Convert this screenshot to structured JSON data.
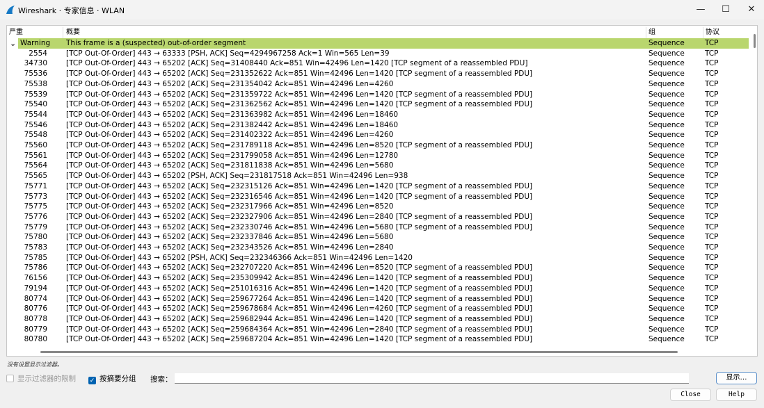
{
  "window": {
    "title": "Wireshark · 专家信息 · WLAN",
    "minimize": "—",
    "maximize": "☐",
    "close": "✕"
  },
  "columns": {
    "severity": "严重",
    "summary": "概要",
    "group": "组",
    "protocol": "协议"
  },
  "group_row": {
    "severity": "Warning",
    "summary": "This frame is a (suspected) out-of-order segment",
    "group": "Sequence",
    "protocol": "TCP",
    "color": "#b9d66e"
  },
  "rows": [
    [
      "2554",
      "[TCP Out-Of-Order] 443 → 63333 [PSH, ACK] Seq=4294967258 Ack=1 Win=565 Len=39"
    ],
    [
      "34730",
      "[TCP Out-Of-Order] 443 → 65202 [ACK] Seq=31408440 Ack=851 Win=42496 Len=1420 [TCP segment of a reassembled PDU]"
    ],
    [
      "75536",
      "[TCP Out-Of-Order] 443 → 65202 [ACK] Seq=231352622 Ack=851 Win=42496 Len=1420 [TCP segment of a reassembled PDU]"
    ],
    [
      "75538",
      "[TCP Out-Of-Order] 443 → 65202 [ACK] Seq=231354042 Ack=851 Win=42496 Len=4260"
    ],
    [
      "75539",
      "[TCP Out-Of-Order] 443 → 65202 [ACK] Seq=231359722 Ack=851 Win=42496 Len=1420 [TCP segment of a reassembled PDU]"
    ],
    [
      "75540",
      "[TCP Out-Of-Order] 443 → 65202 [ACK] Seq=231362562 Ack=851 Win=42496 Len=1420 [TCP segment of a reassembled PDU]"
    ],
    [
      "75544",
      "[TCP Out-Of-Order] 443 → 65202 [ACK] Seq=231363982 Ack=851 Win=42496 Len=18460"
    ],
    [
      "75546",
      "[TCP Out-Of-Order] 443 → 65202 [ACK] Seq=231382442 Ack=851 Win=42496 Len=18460"
    ],
    [
      "75548",
      "[TCP Out-Of-Order] 443 → 65202 [ACK] Seq=231402322 Ack=851 Win=42496 Len=4260"
    ],
    [
      "75560",
      "[TCP Out-Of-Order] 443 → 65202 [ACK] Seq=231789118 Ack=851 Win=42496 Len=8520 [TCP segment of a reassembled PDU]"
    ],
    [
      "75561",
      "[TCP Out-Of-Order] 443 → 65202 [ACK] Seq=231799058 Ack=851 Win=42496 Len=12780"
    ],
    [
      "75564",
      "[TCP Out-Of-Order] 443 → 65202 [ACK] Seq=231811838 Ack=851 Win=42496 Len=5680"
    ],
    [
      "75565",
      "[TCP Out-Of-Order] 443 → 65202 [PSH, ACK] Seq=231817518 Ack=851 Win=42496 Len=938"
    ],
    [
      "75771",
      "[TCP Out-Of-Order] 443 → 65202 [ACK] Seq=232315126 Ack=851 Win=42496 Len=1420 [TCP segment of a reassembled PDU]"
    ],
    [
      "75773",
      "[TCP Out-Of-Order] 443 → 65202 [ACK] Seq=232316546 Ack=851 Win=42496 Len=1420 [TCP segment of a reassembled PDU]"
    ],
    [
      "75775",
      "[TCP Out-Of-Order] 443 → 65202 [ACK] Seq=232317966 Ack=851 Win=42496 Len=8520"
    ],
    [
      "75776",
      "[TCP Out-Of-Order] 443 → 65202 [ACK] Seq=232327906 Ack=851 Win=42496 Len=2840 [TCP segment of a reassembled PDU]"
    ],
    [
      "75779",
      "[TCP Out-Of-Order] 443 → 65202 [ACK] Seq=232330746 Ack=851 Win=42496 Len=5680 [TCP segment of a reassembled PDU]"
    ],
    [
      "75780",
      "[TCP Out-Of-Order] 443 → 65202 [ACK] Seq=232337846 Ack=851 Win=42496 Len=5680"
    ],
    [
      "75783",
      "[TCP Out-Of-Order] 443 → 65202 [ACK] Seq=232343526 Ack=851 Win=42496 Len=2840"
    ],
    [
      "75785",
      "[TCP Out-Of-Order] 443 → 65202 [PSH, ACK] Seq=232346366 Ack=851 Win=42496 Len=1420"
    ],
    [
      "75786",
      "[TCP Out-Of-Order] 443 → 65202 [ACK] Seq=232707220 Ack=851 Win=42496 Len=8520 [TCP segment of a reassembled PDU]"
    ],
    [
      "76156",
      "[TCP Out-Of-Order] 443 → 65202 [ACK] Seq=235309942 Ack=851 Win=42496 Len=1420 [TCP segment of a reassembled PDU]"
    ],
    [
      "79194",
      "[TCP Out-Of-Order] 443 → 65202 [ACK] Seq=251016316 Ack=851 Win=42496 Len=1420 [TCP segment of a reassembled PDU]"
    ],
    [
      "80774",
      "[TCP Out-Of-Order] 443 → 65202 [ACK] Seq=259677264 Ack=851 Win=42496 Len=1420 [TCP segment of a reassembled PDU]"
    ],
    [
      "80776",
      "[TCP Out-Of-Order] 443 → 65202 [ACK] Seq=259678684 Ack=851 Win=42496 Len=4260 [TCP segment of a reassembled PDU]"
    ],
    [
      "80778",
      "[TCP Out-Of-Order] 443 → 65202 [ACK] Seq=259682944 Ack=851 Win=42496 Len=1420 [TCP segment of a reassembled PDU]"
    ],
    [
      "80779",
      "[TCP Out-Of-Order] 443 → 65202 [ACK] Seq=259684364 Ack=851 Win=42496 Len=2840 [TCP segment of a reassembled PDU]"
    ],
    [
      "80780",
      "[TCP Out-Of-Order] 443 → 65202 [ACK] Seq=259687204 Ack=851 Win=42496 Len=1420 [TCP segment of a reassembled PDU]"
    ]
  ],
  "row_group": "Sequence",
  "row_protocol": "TCP",
  "status": "没有设置显示过滤器。",
  "filters": {
    "limit_label": "显示过滤器的限制",
    "limit_checked": false,
    "group_label": "按摘要分组",
    "group_checked": true,
    "check_mark": "✓",
    "search_label": "搜索：",
    "search_value": ""
  },
  "buttons": {
    "show": "显示…",
    "close": "Close",
    "help": "Help"
  },
  "icons": {
    "expand": "⌄"
  }
}
